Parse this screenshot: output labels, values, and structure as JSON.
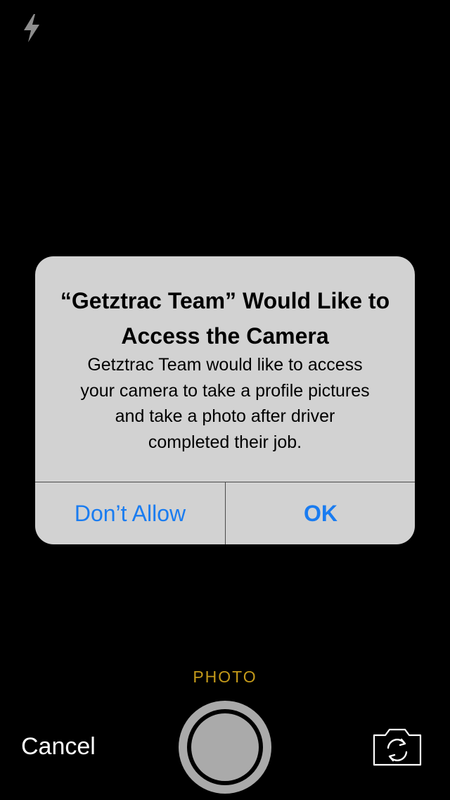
{
  "camera": {
    "flash_icon": "lightning-bolt-icon",
    "mode_label": "PHOTO",
    "cancel_label": "Cancel",
    "shutter_icon": "shutter-button",
    "switch_camera_icon": "camera-rotate-icon"
  },
  "alert": {
    "title": "“Getztrac Team” Would Like to Access the Camera",
    "message": "Getztrac Team would like to access\nyour camera to take  a profile  pictures\nand take a photo after driver\ncompleted their job.",
    "deny_label": "Don’t Allow",
    "ok_label": "OK"
  },
  "colors": {
    "background": "#000000",
    "alert_background": "#d2d2d2",
    "button_blue": "#1a7cf0",
    "mode_gold": "#c49a1a",
    "shutter_gray": "#aaaaaa"
  }
}
